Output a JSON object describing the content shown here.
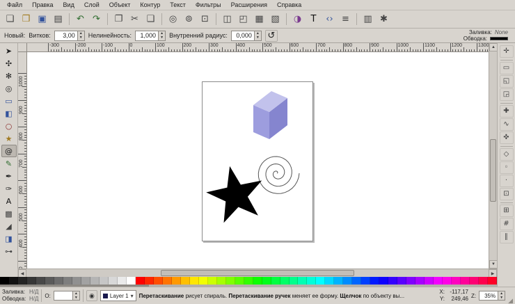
{
  "theme": {
    "chrome": "#d8d4ce",
    "canvas": "#ffffff",
    "active_tool_bg": "#bdb8b1"
  },
  "menubar": {
    "items": [
      "Файл",
      "Правка",
      "Вид",
      "Слой",
      "Объект",
      "Контур",
      "Текст",
      "Фильтры",
      "Расширения",
      "Справка"
    ]
  },
  "toolbar": {
    "groups": [
      [
        {
          "name": "new-document",
          "icon": "new-icon"
        },
        {
          "name": "open-document",
          "icon": "open-icon"
        },
        {
          "name": "save-document",
          "icon": "save-icon"
        },
        {
          "name": "print-document",
          "icon": "print-icon"
        }
      ],
      [
        {
          "name": "undo",
          "icon": "undo-icon"
        },
        {
          "name": "redo",
          "icon": "redo-icon"
        }
      ],
      [
        {
          "name": "copy",
          "icon": "copy-icon"
        },
        {
          "name": "cut",
          "icon": "cut-icon"
        },
        {
          "name": "paste",
          "icon": "paste-icon"
        }
      ],
      [
        {
          "name": "zoom-selection",
          "icon": "zoom-selection-icon"
        },
        {
          "name": "zoom-drawing",
          "icon": "zoom-drawing-icon"
        },
        {
          "name": "zoom-page",
          "icon": "zoom-page-icon"
        }
      ],
      [
        {
          "name": "duplicate",
          "icon": "duplicate-icon"
        },
        {
          "name": "clone",
          "icon": "clone-icon"
        },
        {
          "name": "group",
          "icon": "group-icon"
        },
        {
          "name": "ungroup",
          "icon": "ungroup-icon"
        }
      ],
      [
        {
          "name": "fill-stroke-dialog",
          "icon": "fill-stroke-icon"
        },
        {
          "name": "text-dialog",
          "icon": "text-dialog-icon"
        },
        {
          "name": "xml-editor",
          "icon": "xml-icon"
        },
        {
          "name": "align-dialog",
          "icon": "align-icon"
        }
      ],
      [
        {
          "name": "document-properties",
          "icon": "document-properties-icon"
        },
        {
          "name": "inkscape-preferences",
          "icon": "preferences-icon"
        }
      ]
    ]
  },
  "tool_options": {
    "mode_label": "Новый:",
    "params": [
      {
        "name": "turns",
        "label": "Витков:",
        "value": "3,00"
      },
      {
        "name": "divergence",
        "label": "Нелинейность:",
        "value": "1,000"
      },
      {
        "name": "inner-radius",
        "label": "Внутренний радиус:",
        "value": "0,000"
      }
    ],
    "fill_label": "Заливка:",
    "fill_value": "None",
    "stroke_label": "Обводка:",
    "stroke_color": "#000000"
  },
  "toolbox": {
    "tools": [
      {
        "name": "selector-tool",
        "icon": "selector-tool-icon"
      },
      {
        "name": "node-tool",
        "icon": "node-tool-icon"
      },
      {
        "name": "tweak-tool",
        "icon": "tweak-tool-icon"
      },
      {
        "name": "zoom-tool",
        "icon": "zoom-tool-icon"
      },
      {
        "name": "rect-tool",
        "icon": "rect-tool-icon"
      },
      {
        "name": "box3d-tool",
        "icon": "box3d-tool-icon"
      },
      {
        "name": "ellipse-tool",
        "icon": "ellipse-tool-icon"
      },
      {
        "name": "star-tool",
        "icon": "star-tool-icon"
      },
      {
        "name": "spiral-tool",
        "icon": "spiral-tool-icon",
        "active": true
      },
      {
        "name": "pencil-tool",
        "icon": "pencil-tool-icon"
      },
      {
        "name": "pen-tool",
        "icon": "pen-tool-icon"
      },
      {
        "name": "calligraphy-tool",
        "icon": "calligraphy-tool-icon"
      },
      {
        "name": "text-tool",
        "icon": "text-letter-icon"
      },
      {
        "name": "gradient-tool",
        "icon": "gradient-tool-icon"
      },
      {
        "name": "dropper-tool",
        "icon": "dropper-tool-icon"
      },
      {
        "name": "bucket-tool",
        "icon": "bucket-tool-icon"
      },
      {
        "name": "connector-tool",
        "icon": "connector-tool-icon"
      }
    ]
  },
  "snapbar": {
    "groups": [
      [
        "snap-toggle"
      ],
      [
        "snap-bbox",
        "snap-bbox-edges",
        "snap-bbox-corners"
      ],
      [
        "snap-nodes",
        "snap-paths",
        "snap-intersections"
      ],
      [
        "snap-cusp-nodes",
        "snap-smooth-nodes",
        "snap-midpoints",
        "snap-centers"
      ],
      [
        "snap-page-border",
        "snap-grid",
        "snap-guides"
      ]
    ]
  },
  "rulers": {
    "horizontal": {
      "start": -300,
      "end": 1300,
      "step": 100
    },
    "vertical": {
      "start": 1000,
      "end": 300,
      "step": -100
    }
  },
  "canvas_shapes": {
    "box3d": {
      "top_color": "#c2c2ec",
      "front_color": "#9d9dde",
      "side_color": "#8585cf"
    },
    "spiral": {
      "turns": 3,
      "stroke": "#555555"
    },
    "star": {
      "points": 5,
      "fill": "#000000"
    }
  },
  "palette": {
    "colors": [
      "#000000",
      "#121212",
      "#242424",
      "#363636",
      "#484848",
      "#5a5a5a",
      "#6c6c6c",
      "#7e7e7e",
      "#909090",
      "#a2a2a2",
      "#b4b4b4",
      "#c6c6c6",
      "#d8d8d8",
      "#eaeaea",
      "#ffffff",
      "#ff0000",
      "#ff2600",
      "#ff4d00",
      "#ff7300",
      "#ff9900",
      "#ffbf00",
      "#ffe600",
      "#f2ff00",
      "#ccff00",
      "#a6ff00",
      "#80ff00",
      "#59ff00",
      "#33ff00",
      "#0dff00",
      "#00ff1a",
      "#00ff40",
      "#00ff66",
      "#00ff8c",
      "#00ffb3",
      "#00ffd9",
      "#00ffff",
      "#00d9ff",
      "#00b3ff",
      "#008cff",
      "#0066ff",
      "#0040ff",
      "#001aff",
      "#0d00ff",
      "#3300ff",
      "#5900ff",
      "#8000ff",
      "#a600ff",
      "#cc00ff",
      "#f200ff",
      "#ff00e6",
      "#ff00bf",
      "#ff0099",
      "#ff0073",
      "#ff004d",
      "#ff0026"
    ]
  },
  "statusbar": {
    "fill_label": "Заливка:",
    "fill_value": "Н/Д",
    "stroke_label": "Обводка:",
    "stroke_value": "Н/Д",
    "opacity_label": "О:",
    "opacity_value": "",
    "layer_label": "Layer 1",
    "message_segments": [
      {
        "text": "Перетаскивание",
        "bold": true
      },
      {
        "text": " рисует спираль. ",
        "bold": false
      },
      {
        "text": "Перетаскивание ручек",
        "bold": true
      },
      {
        "text": " меняет ее форму. ",
        "bold": false
      },
      {
        "text": "Щелчок",
        "bold": true
      },
      {
        "text": " по объекту вы...",
        "bold": false
      }
    ],
    "x_label": "X:",
    "x_value": "-117,17",
    "y_label": "Y:",
    "y_value": "249,46",
    "zoom_label": "Z:",
    "zoom_value": "35%"
  }
}
